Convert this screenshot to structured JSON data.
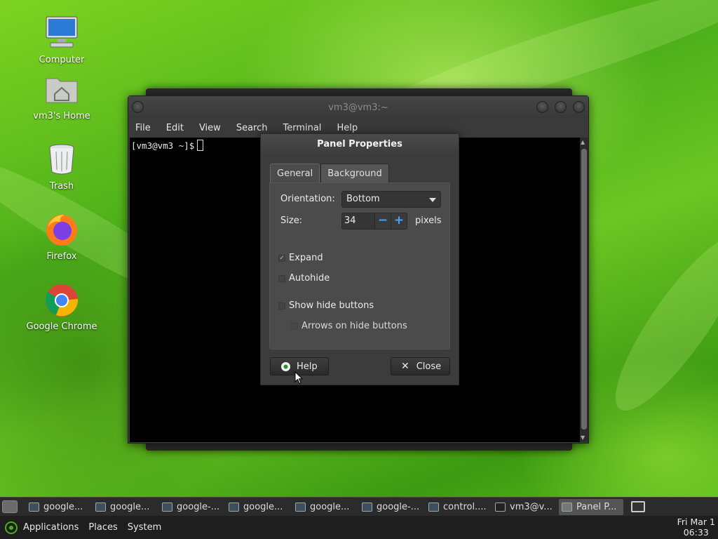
{
  "desktop": {
    "icons": [
      {
        "label": "Computer"
      },
      {
        "label": "vm3's Home"
      },
      {
        "label": "Trash"
      },
      {
        "label": "Firefox"
      },
      {
        "label": "Google Chrome"
      }
    ]
  },
  "terminal": {
    "title": "vm3@vm3:~",
    "menu": [
      "File",
      "Edit",
      "View",
      "Search",
      "Terminal",
      "Help"
    ],
    "prompt": "[vm3@vm3 ~]$"
  },
  "dialog": {
    "title": "Panel Properties",
    "tabs": [
      "General",
      "Background"
    ],
    "orientation_label": "Orientation:",
    "orientation_value": "Bottom",
    "size_label": "Size:",
    "size_value": "34",
    "size_unit": "pixels",
    "expand_label": "Expand",
    "expand_checked": true,
    "autohide_label": "Autohide",
    "autohide_checked": false,
    "show_hide_buttons_label": "Show hide buttons",
    "show_hide_buttons_checked": false,
    "arrows_label": "Arrows on hide buttons",
    "arrows_checked": false,
    "help_button": "Help",
    "close_button": "Close"
  },
  "taskbar": {
    "tasks": [
      {
        "label": "google..."
      },
      {
        "label": "google..."
      },
      {
        "label": "google-..."
      },
      {
        "label": "google..."
      },
      {
        "label": "google..."
      },
      {
        "label": "google-..."
      },
      {
        "label": "control...."
      },
      {
        "label": "vm3@v..."
      },
      {
        "label": "Panel P..."
      }
    ]
  },
  "bottom_panel": {
    "applications": "Applications",
    "places": "Places",
    "system": "System",
    "clock_date": "Fri Mar 1",
    "clock_time": "06:33"
  }
}
